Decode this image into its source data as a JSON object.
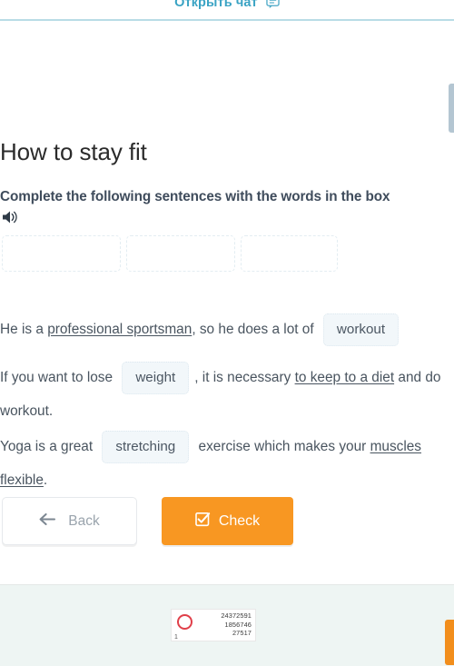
{
  "top_bar": {
    "open_chat_label": "Открыть чат",
    "chat_icon": "chat-bubble-icon",
    "divider_color": "#b9dce6"
  },
  "lesson": {
    "title": "How to stay fit",
    "instruction": "Complete the following sentences with the words in the box",
    "audio_icon": "speaker-icon"
  },
  "word_bank": {
    "boxes": [
      {
        "value": ""
      },
      {
        "value": ""
      },
      {
        "value": ""
      }
    ]
  },
  "sentences": [
    {
      "id": "sentence-1",
      "parts": [
        {
          "type": "text",
          "text": "He is a "
        },
        {
          "type": "underline",
          "text": "professional sportsman"
        },
        {
          "type": "text",
          "text": ", so he does a lot of "
        },
        {
          "type": "chip",
          "text": "workout"
        }
      ]
    },
    {
      "id": "sentence-2",
      "parts": [
        {
          "type": "text",
          "text": "If you want to lose "
        },
        {
          "type": "chip",
          "text": "weight"
        },
        {
          "type": "text",
          "text": ", it is necessary "
        },
        {
          "type": "underline",
          "text": "to keep to a diet"
        },
        {
          "type": "text",
          "text": " and do workout."
        }
      ]
    },
    {
      "id": "sentence-3",
      "parts": [
        {
          "type": "text",
          "text": "Yoga is a great "
        },
        {
          "type": "chip",
          "text": "stretching"
        },
        {
          "type": "text",
          "text": " exercise which makes your "
        },
        {
          "type": "underline",
          "text": "muscles flexible"
        },
        {
          "type": "text",
          "text": "."
        }
      ]
    }
  ],
  "actions": {
    "back_label": "Back",
    "back_icon": "arrow-left-icon",
    "check_label": "Check",
    "check_icon": "checkbox-checked-icon",
    "check_color": "#f89722"
  },
  "footer": {
    "watermark": {
      "left_digit": "1",
      "numbers": [
        "24372591",
        "1856746",
        "27517"
      ],
      "ring_color": "#e0404a"
    }
  },
  "chrome": {
    "scroll_indicator": "scrollbar-thumb",
    "corner_tab": "side-tab"
  }
}
